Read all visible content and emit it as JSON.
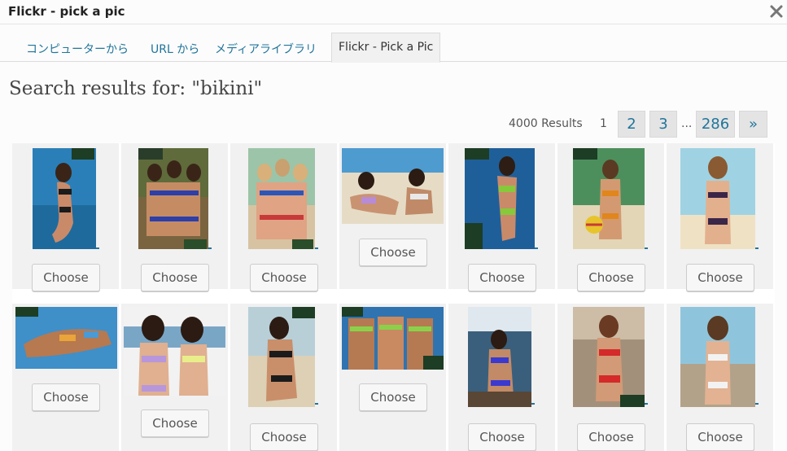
{
  "window": {
    "title": "Flickr - pick a pic"
  },
  "tabs": [
    {
      "label": "コンピューターから"
    },
    {
      "label": "URL から"
    },
    {
      "label": "メディアライブラリ"
    },
    {
      "label": "Flickr - Pick a Pic"
    }
  ],
  "search": {
    "heading": "Search results for: \"bikini\""
  },
  "pagination": {
    "results_text": "4000 Results",
    "current": "1",
    "pages": [
      "2",
      "3",
      "286"
    ],
    "ellipsis": "...",
    "next": "»"
  },
  "grid": {
    "choose_label": "Choose",
    "photo_count": 14
  },
  "colors": {
    "link": "#21759b",
    "cell_bg": "#f1f1f1",
    "tab_active_bg": "#f1f1f1"
  }
}
